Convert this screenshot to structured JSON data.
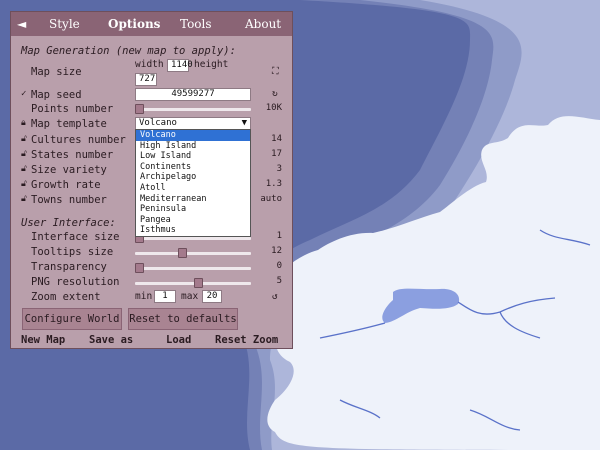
{
  "tabs": {
    "collapse_glyph": "◄",
    "items": [
      "Style",
      "Options",
      "Tools",
      "About"
    ],
    "active": "Options"
  },
  "map_generation": {
    "title": "Map Generation (new map to apply):",
    "map_size": {
      "label": "Map size",
      "width_label": "width",
      "width_value": "1140",
      "height_label": "height",
      "height_value": "727"
    },
    "map_seed": {
      "label": "Map seed",
      "value": "49599277"
    },
    "points_number": {
      "label": "Points number",
      "value": "10K",
      "level": 0.0
    },
    "map_template": {
      "label": "Map template",
      "selected": "Volcano",
      "options": [
        "Volcano",
        "High Island",
        "Low Island",
        "Continents",
        "Archipelago",
        "Atoll",
        "Mediterranean",
        "Peninsula",
        "Pangea",
        "Isthmus"
      ]
    },
    "cultures_number": {
      "label": "Cultures number",
      "value": "14"
    },
    "states_number": {
      "label": "States number",
      "value": "17"
    },
    "size_variety": {
      "label": "Size variety",
      "value": "3"
    },
    "growth_rate": {
      "label": "Growth rate",
      "value": "1.3"
    },
    "towns_number": {
      "label": "Towns number",
      "value": "auto"
    }
  },
  "user_interface": {
    "title": "User Interface:",
    "interface_size": {
      "label": "Interface size",
      "value": "1",
      "level": 0.0
    },
    "tooltips_size": {
      "label": "Tooltips size",
      "value": "12",
      "level": 0.4
    },
    "transparency": {
      "label": "Transparency",
      "value": "0",
      "level": 0.0
    },
    "png_resolution": {
      "label": "PNG resolution",
      "value": "5",
      "level": 0.55
    },
    "zoom_extent": {
      "label": "Zoom extent",
      "min_label": "min",
      "min_value": "1",
      "max_label": "max",
      "max_value": "20"
    }
  },
  "buttons": {
    "configure_world": "Configure World",
    "reset_defaults": "Reset to defaults"
  },
  "bottom_bar": {
    "new_map": "New Map",
    "save_as": "Save as",
    "load": "Load",
    "reset_zoom": "Reset Zoom"
  },
  "colors": {
    "ocean": "#5b6aa6",
    "land": "#eef2fa",
    "panel": "#b99fab",
    "panel_header": "#8a6475",
    "lake": "#8b9fe0"
  }
}
